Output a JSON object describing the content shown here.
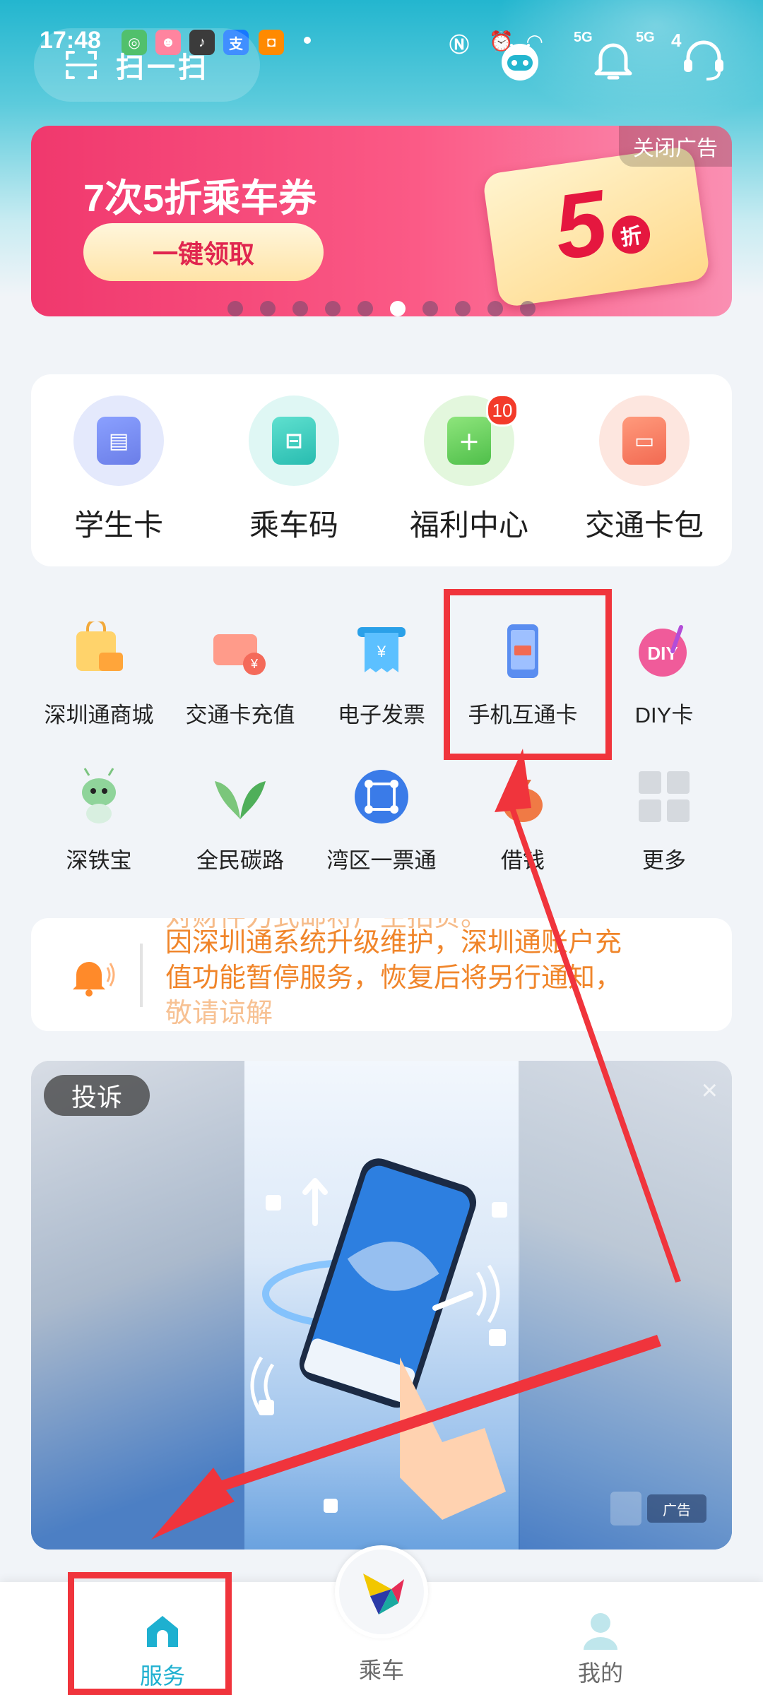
{
  "status_bar": {
    "time": "17:48",
    "notification_dot": "•",
    "network": "5G",
    "battery": "4"
  },
  "header": {
    "scan_label": "扫一扫"
  },
  "banner": {
    "title": "7次5折乘车券",
    "claim_button": "一键领取",
    "close_ad": "关闭广告",
    "ticket_value": "5",
    "ticket_unit": "折",
    "page_count": 10,
    "active_page": 6
  },
  "main_services": [
    {
      "label": "学生卡",
      "icon": "student-card-icon",
      "color": "#7b8df0"
    },
    {
      "label": "乘车码",
      "icon": "ride-code-icon",
      "color": "#3fd0c0"
    },
    {
      "label": "福利中心",
      "icon": "gift-icon",
      "color": "#6fd36a",
      "badge": "10"
    },
    {
      "label": "交通卡包",
      "icon": "wallet-icon",
      "color": "#f7806a"
    }
  ],
  "grid_row1": [
    {
      "label": "深圳通商城",
      "icon": "shopping-bag-icon"
    },
    {
      "label": "交通卡充值",
      "icon": "card-topup-icon"
    },
    {
      "label": "电子发票",
      "icon": "invoice-icon"
    },
    {
      "label": "手机互通卡",
      "icon": "phone-card-icon"
    },
    {
      "label": "DIY卡",
      "icon": "diy-card-icon"
    }
  ],
  "grid_row2": [
    {
      "label": "深铁宝",
      "icon": "mascot-icon"
    },
    {
      "label": "全民碳路",
      "icon": "leaf-icon"
    },
    {
      "label": "湾区一票通",
      "icon": "bay-area-ticket-icon"
    },
    {
      "label": "借钱",
      "icon": "money-bag-icon"
    },
    {
      "label": "更多",
      "icon": "more-grid-icon"
    }
  ],
  "notice": {
    "line1": "对财件刀式邮将广生拍负。",
    "line2": "因深圳通系统升级维护，深圳通账户充",
    "line3": "值功能暂停服务，恢复后将另行通知，",
    "line4": "敬请谅解"
  },
  "ad": {
    "complain_label": "投诉",
    "close": "×",
    "ad_tag": "广告"
  },
  "bottom_nav": {
    "service": "服务",
    "ride": "乘车",
    "mine": "我的"
  },
  "colors": {
    "accent": "#22b0c9",
    "annotation_red": "#f0343c",
    "notice_orange": "#f0852a"
  }
}
